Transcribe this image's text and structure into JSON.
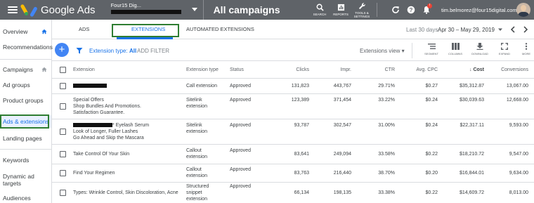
{
  "app": {
    "brand": "Google Ads",
    "account_name": "Four15 Dig...",
    "page_title": "All campaigns",
    "user_email": "tim.belmorez@four15digital.com",
    "notification_count": "!"
  },
  "top_tools": [
    {
      "icon": "search-icon",
      "label": "SEARCH"
    },
    {
      "icon": "reports-icon",
      "label": "REPORTS"
    },
    {
      "icon": "wrench-icon",
      "label": "TOOLS & SETTINGS"
    }
  ],
  "sidebar": {
    "items": [
      {
        "label": "Overview"
      },
      {
        "label": "Recommendations"
      },
      {
        "label": "Campaigns"
      },
      {
        "label": "Ad groups"
      },
      {
        "label": "Product groups"
      },
      {
        "label": "Ads & extensions"
      },
      {
        "label": "Landing pages"
      },
      {
        "label": "Keywords"
      },
      {
        "label": "Dynamic ad targets"
      },
      {
        "label": "Audiences"
      }
    ]
  },
  "tabs": [
    {
      "label": "ADS"
    },
    {
      "label": "EXTENSIONS"
    },
    {
      "label": "AUTOMATED EXTENSIONS"
    }
  ],
  "date": {
    "preset": "Last 30 days",
    "range": "Apr 30 – May 29, 2019"
  },
  "toolbar": {
    "filter_prefix": "Extension type:",
    "filter_value": "All",
    "add_filter": "ADD FILTER",
    "views": "Extensions view",
    "tools": [
      {
        "icon": "segment-icon",
        "label": "SEGMENT"
      },
      {
        "icon": "columns-icon",
        "label": "COLUMNS"
      },
      {
        "icon": "download-icon",
        "label": "DOWNLOAD"
      },
      {
        "icon": "expand-icon",
        "label": "EXPAND"
      },
      {
        "icon": "more-icon",
        "label": "MORE"
      }
    ]
  },
  "table": {
    "headers": {
      "extension": "Extension",
      "type": "Extension type",
      "status": "Status",
      "clicks": "Clicks",
      "impr": "Impr.",
      "ctr": "CTR",
      "avg_cpc": "Avg. CPC",
      "cost": "Cost",
      "conversions": "Conversions"
    },
    "rows": [
      {
        "ext1": "",
        "ext2": "",
        "ext3": "",
        "type1": "Call extension",
        "type2": "",
        "type3": "",
        "status": "Approved",
        "clicks": "131,823",
        "impr": "443,767",
        "ctr": "29.71%",
        "cpc": "$0.27",
        "cost": "$35,312.87",
        "conv": "13,067.00"
      },
      {
        "ext1": "Special Offers",
        "ext2": "Shop Bundles And Promotions.",
        "ext3": "Satisfaction Guarantee.",
        "type1": "Sitelink",
        "type2": "extension",
        "type3": "",
        "status": "Approved",
        "clicks": "123,389",
        "impr": "371,454",
        "ctr": "33.22%",
        "cpc": "$0.24",
        "cost": "$30,039.63",
        "conv": "12,668.00"
      },
      {
        "ext1": "* Eyelash Serum",
        "ext2": "Look of Longer, Fuller Lashes",
        "ext3": "Go Ahead and Skip the Mascara",
        "type1": "Sitelink",
        "type2": "extension",
        "type3": "",
        "status": "Approved",
        "clicks": "93,787",
        "impr": "302,547",
        "ctr": "31.00%",
        "cpc": "$0.24",
        "cost": "$22,317.11",
        "conv": "9,593.00"
      },
      {
        "ext1": "Take Control Of Your Skin",
        "ext2": "",
        "ext3": "",
        "type1": "Callout",
        "type2": "extension",
        "type3": "",
        "status": "Approved",
        "clicks": "83,641",
        "impr": "249,094",
        "ctr": "33.58%",
        "cpc": "$0.22",
        "cost": "$18,210.72",
        "conv": "9,547.00"
      },
      {
        "ext1": "Find Your Regimen",
        "ext2": "",
        "ext3": "",
        "type1": "Callout",
        "type2": "extension",
        "type3": "",
        "status": "Approved",
        "clicks": "83,763",
        "impr": "216,440",
        "ctr": "38.70%",
        "cpc": "$0.20",
        "cost": "$16,844.01",
        "conv": "9,634.00"
      },
      {
        "ext1": "Types: Wrinkle Control, Skin Discoloration, Acne",
        "ext2": "",
        "ext3": "",
        "type1": "Structured",
        "type2": "snippet",
        "type3": "extension",
        "status": "Approved",
        "clicks": "66,134",
        "impr": "198,135",
        "ctr": "33.38%",
        "cpc": "$0.22",
        "cost": "$14,609.72",
        "conv": "8,013.00"
      }
    ]
  }
}
